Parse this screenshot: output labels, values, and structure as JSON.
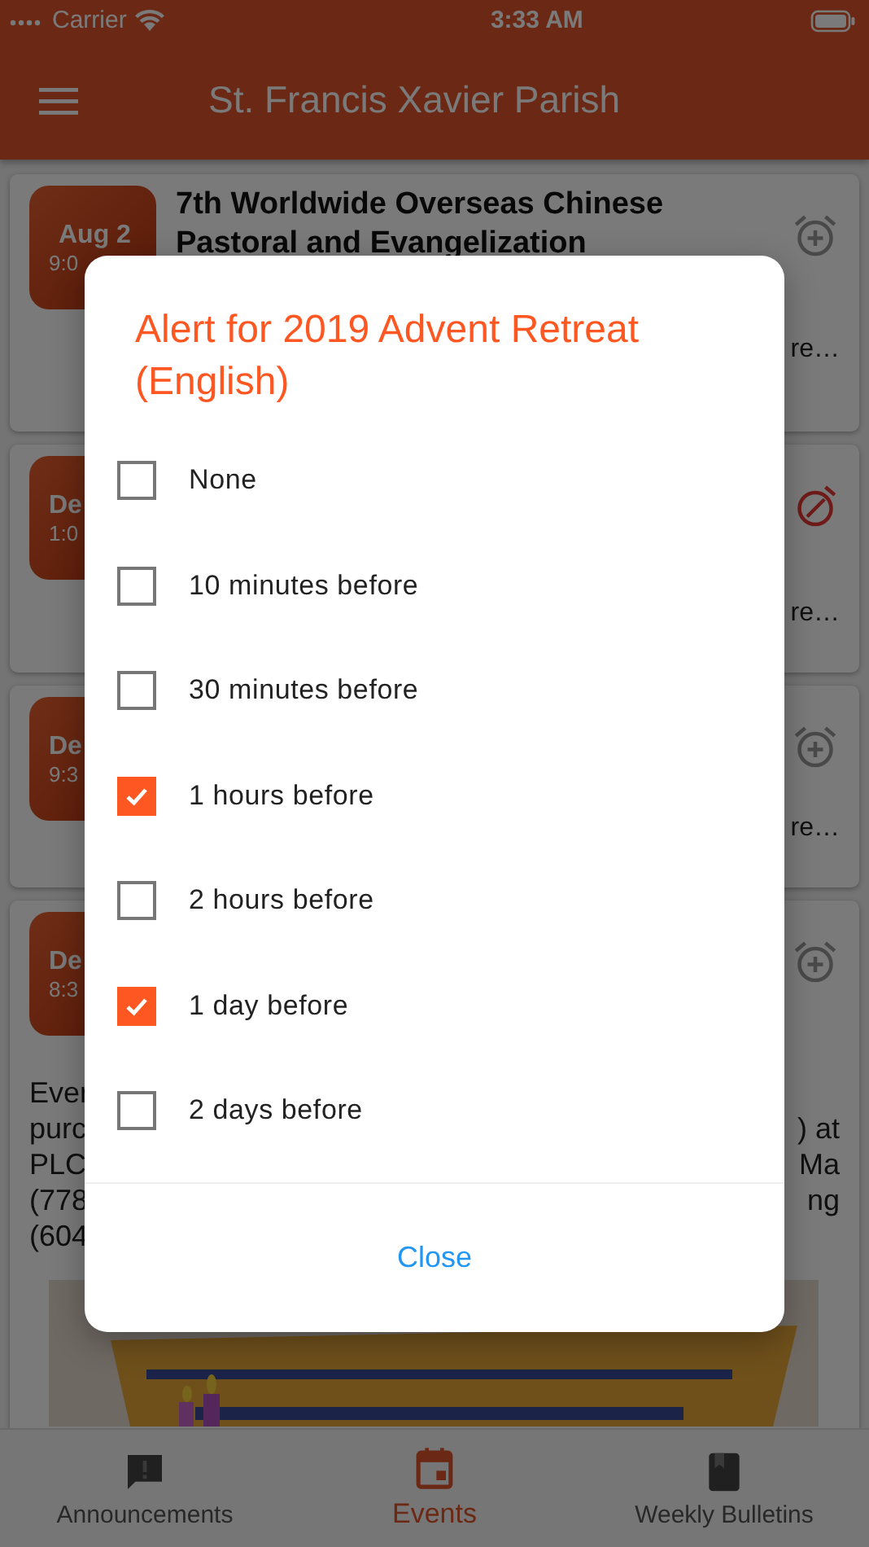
{
  "status_bar": {
    "carrier": "Carrier",
    "time": "3:33 AM"
  },
  "app_bar": {
    "title": "St. Francis Xavier Parish"
  },
  "cards": [
    {
      "badge_lines": [
        "Aug 2",
        "9:0"
      ],
      "title": "7th Worldwide Overseas Chinese Pastoral and Evangelization",
      "kind": "alarm_add",
      "more": "re…"
    },
    {
      "badge_lines": [
        "De",
        "1:0"
      ],
      "kind": "alarm_off",
      "more": "re…"
    },
    {
      "badge_lines": [
        "De",
        "9:3"
      ],
      "kind": "alarm_add",
      "more": "re…"
    },
    {
      "badge_lines": [
        "De",
        "8:3"
      ],
      "kind": "alarm_add",
      "body_left": [
        "Ever",
        "purc",
        "PLC",
        "(778",
        "(604"
      ],
      "body_right": [
        ") at",
        "Ma",
        "ng"
      ],
      "picture": {
        "kind": "picture"
      }
    }
  ],
  "dialog": {
    "title": "Alert for 2019 Advent Retreat (English)",
    "options": [
      {
        "label": "None",
        "checked": false
      },
      {
        "label": "10 minutes before",
        "checked": false
      },
      {
        "label": "30 minutes before",
        "checked": false
      },
      {
        "label": "1 hours before",
        "checked": true
      },
      {
        "label": "2 hours before",
        "checked": false
      },
      {
        "label": "1 day before",
        "checked": true
      },
      {
        "label": "2 days before",
        "checked": false
      }
    ],
    "button": "Close"
  },
  "tabs": [
    {
      "label": "Announcements",
      "selected": false
    },
    {
      "label": "Events",
      "selected": true
    },
    {
      "label": "Weekly Bulletins",
      "selected": false
    }
  ]
}
